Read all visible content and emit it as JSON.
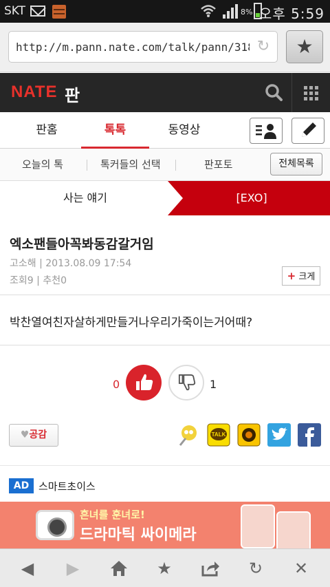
{
  "status_bar": {
    "carrier": "SKT",
    "battery_text": "8%",
    "time": "오후 5:59",
    "icons": [
      "mail-icon",
      "app-icon",
      "wifi-icon",
      "signal-icon",
      "battery-icon"
    ]
  },
  "browser": {
    "url": "http://m.pann.nate.com/talk/pann/318",
    "icons": [
      "reload-icon",
      "bookmark-star-icon"
    ]
  },
  "header": {
    "logo": "NATE",
    "logo_suffix": "판",
    "icons": [
      "search-icon",
      "grid-menu-icon"
    ]
  },
  "tabs": [
    {
      "label": "판홈",
      "active": false
    },
    {
      "label": "톡톡",
      "active": true
    },
    {
      "label": "동영상",
      "active": false
    }
  ],
  "tab_icons": [
    "my-profile-icon",
    "write-icon"
  ],
  "subnav": {
    "items": [
      "오늘의 톡",
      "톡커들의 선택",
      "판포토"
    ],
    "all_list_label": "전체목록"
  },
  "breadcrumb": {
    "category": "사는 얘기",
    "subcategory": "[EXO]"
  },
  "post": {
    "title": "엑소팬들아꼭봐동감갈거임",
    "author": "고소해",
    "date": "2013.08.09 17:54",
    "views_label": "조회",
    "views": "9",
    "recommend_label": "추천",
    "recommend": "0",
    "big_label": "크게",
    "body": "박찬열여친자살하게만들거나우리가죽이는거어때?"
  },
  "votes": {
    "up": "0",
    "down": "1"
  },
  "share": {
    "like_label": "공감",
    "icons": [
      "link-icon",
      "kakaotalk-icon",
      "kakaostory-icon",
      "twitter-icon",
      "facebook-icon"
    ]
  },
  "ad": {
    "badge": "AD",
    "label": "스마트초이스",
    "banner_line1": "흔녀를 훈녀로!",
    "banner_line2": "드라마틱 싸이메라"
  },
  "bottom_nav": [
    "back-icon",
    "forward-icon",
    "home-icon",
    "bookmark-icon",
    "share-icon",
    "refresh-icon",
    "close-icon"
  ],
  "colors": {
    "accent": "#d8282f",
    "header_bg": "#262626",
    "crumb_red": "#c5000d",
    "ad_blue": "#1a6fd1",
    "banner": "#f3826e"
  }
}
